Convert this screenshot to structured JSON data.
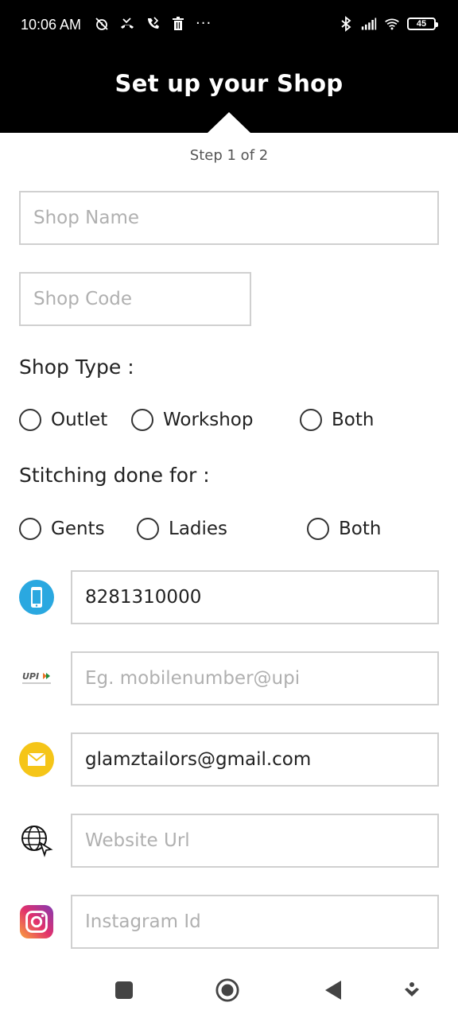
{
  "status_bar": {
    "time": "10:06 AM",
    "icons_left": [
      "alarm-off-icon",
      "missed-call-icon",
      "call-forward-icon",
      "trash-icon",
      "more-dots-icon"
    ],
    "more_dots": "···",
    "icons_right": [
      "bluetooth-icon",
      "signal-icon",
      "wifi-icon",
      "battery-icon"
    ],
    "battery_level": "45"
  },
  "header": {
    "title": "Set up your Shop"
  },
  "step_indicator": "Step 1 of 2",
  "form": {
    "shop_name": {
      "placeholder": "Shop Name",
      "value": ""
    },
    "shop_code": {
      "placeholder": "Shop Code",
      "value": ""
    },
    "shop_type": {
      "label": "Shop Type :",
      "options": [
        "Outlet",
        "Workshop",
        "Both"
      ],
      "selected": null
    },
    "stitching_for": {
      "label": "Stitching done for :",
      "options": [
        "Gents",
        "Ladies",
        "Both"
      ],
      "selected": null
    },
    "contacts": [
      {
        "icon": "phone-icon",
        "placeholder": "",
        "value": "8281310000"
      },
      {
        "icon": "upi-icon",
        "placeholder": "Eg. mobilenumber@upi",
        "value": ""
      },
      {
        "icon": "email-icon",
        "placeholder": "",
        "value": "glamztailors@gmail.com"
      },
      {
        "icon": "website-icon",
        "placeholder": "Website Url",
        "value": ""
      },
      {
        "icon": "instagram-icon",
        "placeholder": "Instagram Id",
        "value": ""
      }
    ]
  },
  "nav_bar": {
    "buttons": [
      "recents-button",
      "home-button",
      "back-button",
      "assistant-button"
    ]
  },
  "colors": {
    "header_bg": "#000000",
    "phone_icon": "#2aa8e0",
    "email_icon": "#f5c518",
    "field_border": "#d0d0d0",
    "placeholder": "#b0b0b0"
  }
}
